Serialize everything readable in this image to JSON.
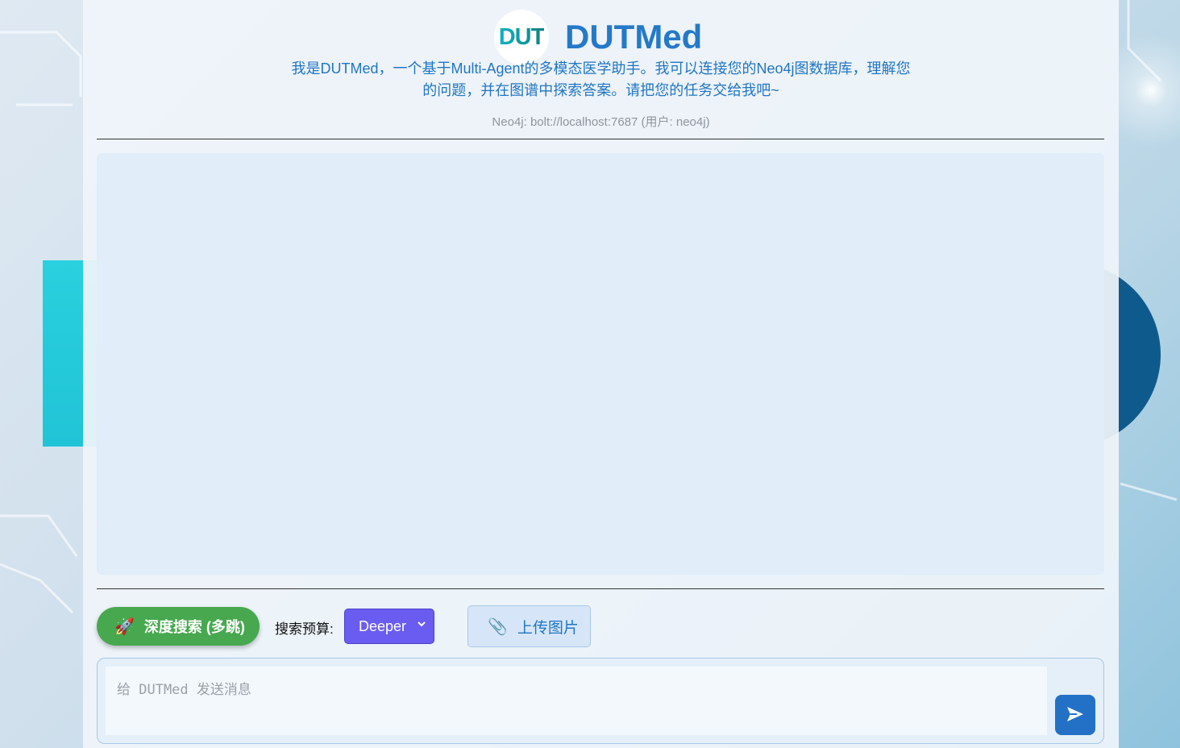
{
  "header": {
    "logo_text": "DUT",
    "title": "DUTMed",
    "subtitle": "我是DUTMed，一个基于Multi-Agent的多模态医学助手。我可以连接您的Neo4j图数据库，理解您的问题，并在图谱中探索答案。请把您的任务交给我吧~",
    "connection": "Neo4j: bolt://localhost:7687 (用户: neo4j)"
  },
  "toolbar": {
    "deep_search_icon": "🚀",
    "deep_search_label": "深度搜索 (多跳)",
    "budget_label": "搜索预算:",
    "budget_value": "Deeper",
    "upload_icon": "📎",
    "upload_label": "上传图片"
  },
  "composer": {
    "placeholder": "给 DUTMed 发送消息"
  },
  "colors": {
    "accent": "#2479c8",
    "deep_search_green": "#47a84f",
    "budget_purple": "#6a5cf0",
    "send_blue": "#2271c6"
  },
  "icons": {
    "send": "send-arrow-icon",
    "rocket": "rocket-icon",
    "clip": "paperclip-icon"
  }
}
